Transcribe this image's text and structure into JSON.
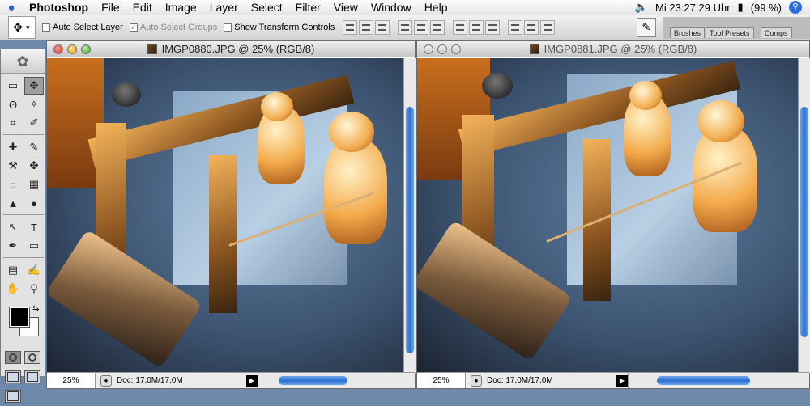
{
  "menubar": {
    "apple": "",
    "app": "Photoshop",
    "items": [
      "File",
      "Edit",
      "Image",
      "Layer",
      "Select",
      "Filter",
      "View",
      "Window",
      "Help"
    ],
    "clock": "Mi 23:27:29 Uhr",
    "battery": "(99 %)"
  },
  "options": {
    "auto_select_layer": "Auto Select Layer",
    "auto_select_groups": "Auto Select Groups",
    "show_transform": "Show Transform Controls",
    "well_tabs": [
      "Brushes",
      "Tool Presets",
      "Comps"
    ]
  },
  "toolbox": {
    "tools": [
      "▭",
      "✥",
      "ʘ",
      "✧",
      "⌗",
      "✐",
      "✚",
      "✎",
      "⚒",
      "✤",
      "◌",
      "▦",
      "▲",
      "●",
      "↖",
      "T",
      "✒",
      "▭",
      "▤",
      "✍",
      "✋",
      "⚲"
    ],
    "swap": "⇆"
  },
  "documents": [
    {
      "title": "IMGP0880.JPG @ 25% (RGB/8)",
      "zoom": "25%",
      "doc": "Doc: 17,0M/17,0M",
      "active": true
    },
    {
      "title": "IMGP0881.JPG @ 25% (RGB/8)",
      "zoom": "25%",
      "doc": "Doc: 17,0M/17,0M",
      "active": false
    }
  ],
  "colors": {
    "scroll_accent": "#2c6fd4",
    "menu_bg": "#f0f0f0",
    "desktop": "#6e88a9"
  }
}
